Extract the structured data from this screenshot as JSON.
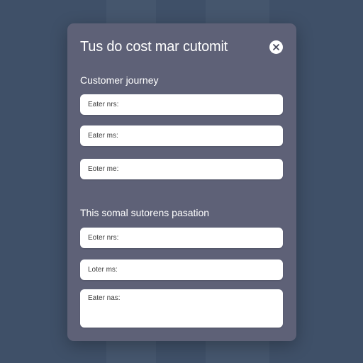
{
  "dialog": {
    "title": "Tus do cost mar cutomit",
    "close_icon": "close-icon"
  },
  "sections": [
    {
      "label": "Customer journey",
      "fields": [
        {
          "placeholder": "Eater nrs:"
        },
        {
          "placeholder": "Eater ms:"
        },
        {
          "placeholder": "Eoter me:"
        }
      ]
    },
    {
      "label": "This somal sutorens pasation",
      "fields": [
        {
          "placeholder": "Eoter nrs:"
        },
        {
          "placeholder": "Loter ms:"
        },
        {
          "placeholder": "Eater nas:"
        }
      ]
    }
  ],
  "colors": {
    "background": "#3f5068",
    "dialog": "#5e6177",
    "field": "#ffffff",
    "text_on_dialog": "#ffffff"
  }
}
